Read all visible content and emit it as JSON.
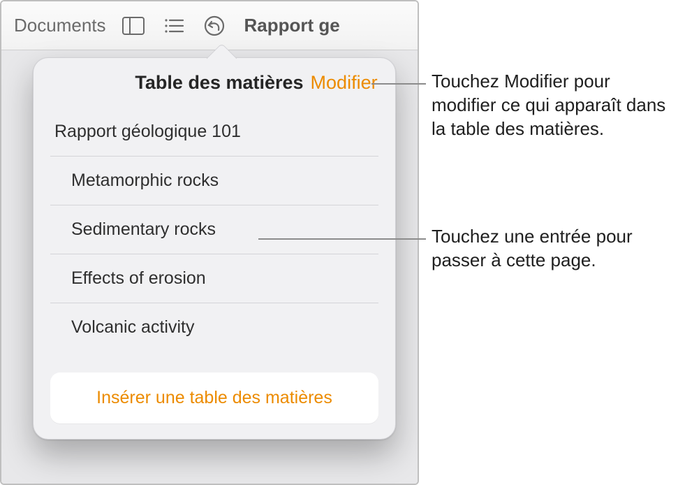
{
  "toolbar": {
    "documents_label": "Documents",
    "title": "Rapport ge"
  },
  "popover": {
    "title": "Table des matières",
    "edit_label": "Modifier",
    "insert_label": "Insérer une table des matières",
    "items": [
      {
        "label": "Rapport géologique 101",
        "level": 1
      },
      {
        "label": "Metamorphic rocks",
        "level": 2
      },
      {
        "label": "Sedimentary rocks",
        "level": 2
      },
      {
        "label": "Effects of erosion",
        "level": 2
      },
      {
        "label": "Volcanic activity",
        "level": 2
      }
    ]
  },
  "callouts": {
    "modifier": "Touchez Modifier pour modifier ce qui apparaît dans la table des matières.",
    "entry": "Touchez une entrée pour passer à cette page."
  }
}
